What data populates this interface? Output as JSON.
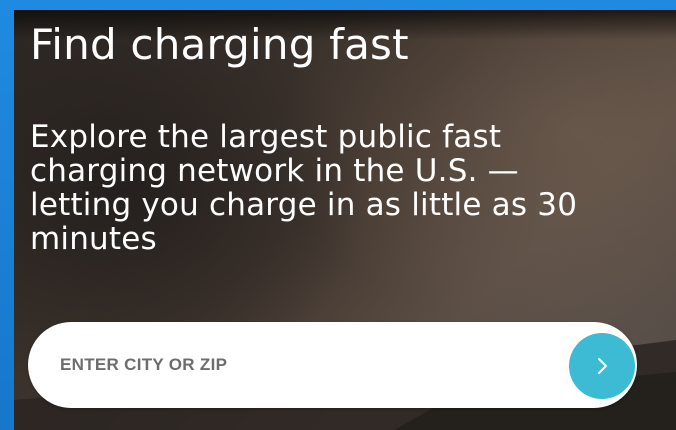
{
  "hero": {
    "title": "Find charging fast",
    "description": "Explore the largest public fast\ncharging network in the U.S. —\nletting you charge in as little as 30\nminutes"
  },
  "search": {
    "placeholder": "ENTER CITY OR ZIP",
    "value": "",
    "submit_icon": "chevron-right-icon"
  },
  "colors": {
    "frame": "#1a7fd6",
    "accent": "#3dbbd4",
    "text": "#ffffff",
    "placeholder": "#6d6d6d"
  }
}
